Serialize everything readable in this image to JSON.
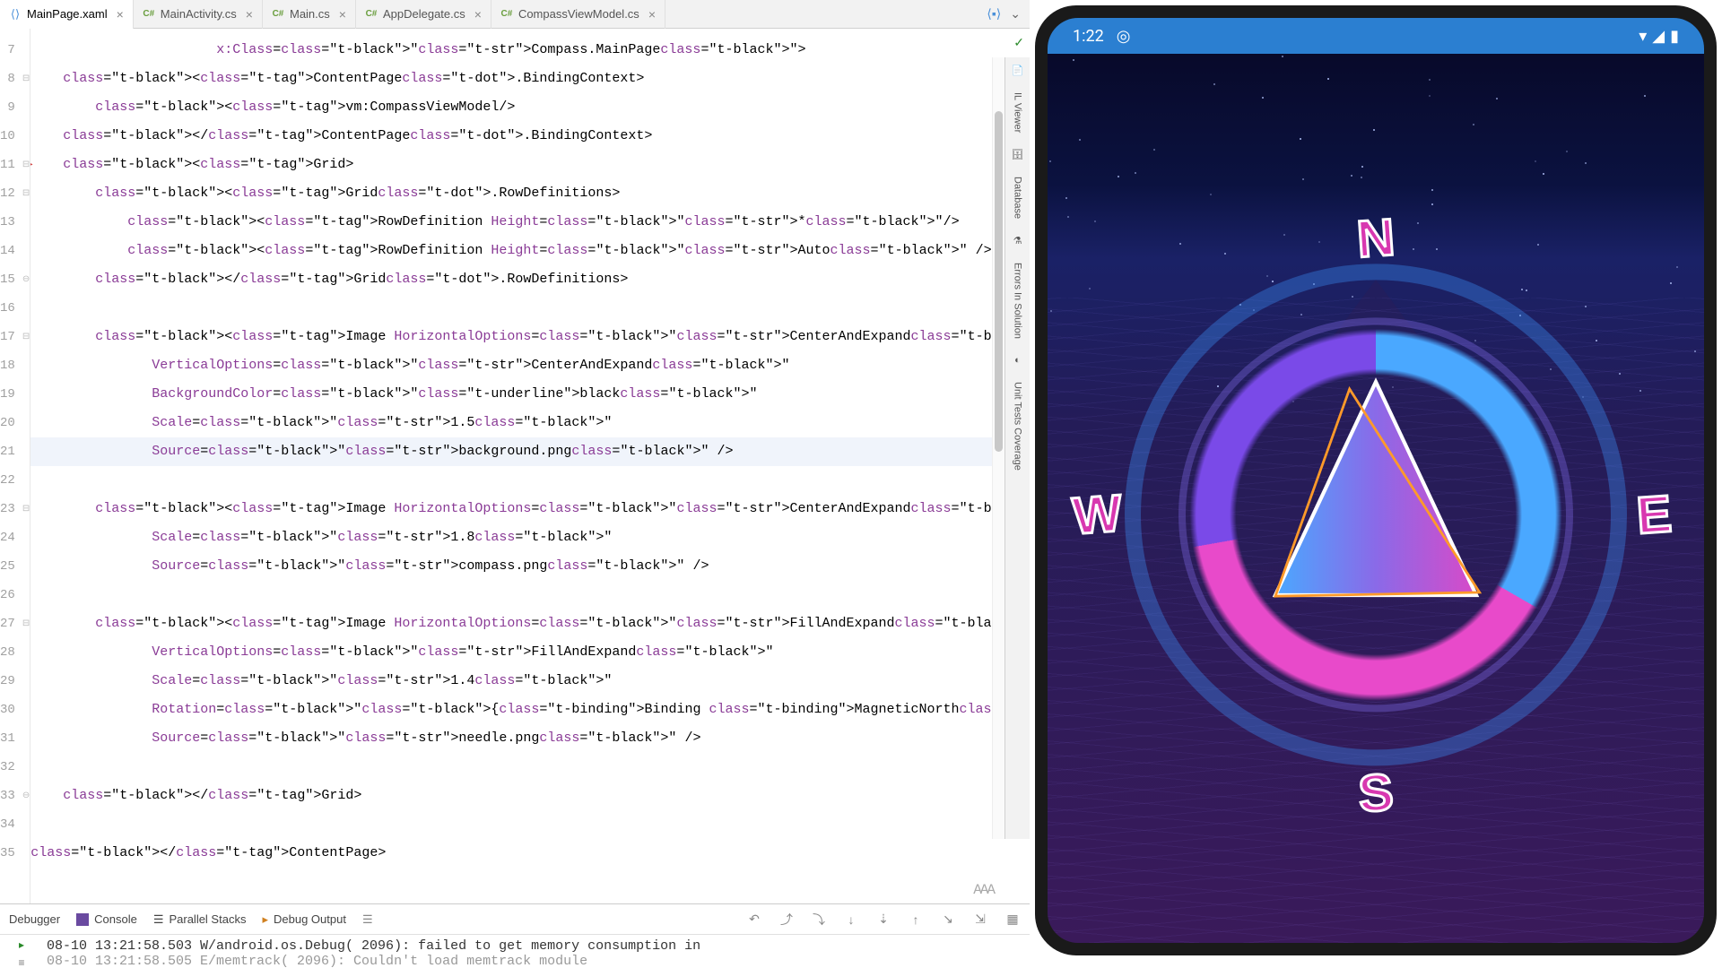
{
  "tabs": [
    {
      "label": "MainPage.xaml",
      "icon": "⟨⟩",
      "color": "#4a90d9",
      "active": true
    },
    {
      "label": "MainActivity.cs",
      "icon": "C#",
      "color": "#6a9e3e"
    },
    {
      "label": "Main.cs",
      "icon": "C#",
      "color": "#6a9e3e"
    },
    {
      "label": "AppDelegate.cs",
      "icon": "C#",
      "color": "#6a9e3e"
    },
    {
      "label": "CompassViewModel.cs",
      "icon": "C#",
      "color": "#6a9e3e"
    }
  ],
  "lines": {
    "start": 7,
    "end": 35,
    "highlight": 21,
    "breakpoint": 11,
    "hammer": 21
  },
  "code": {
    "l7": "                       x:Class=\"Compass.MainPage\">",
    "l8": "    <ContentPage.BindingContext>",
    "l9": "        <vm:CompassViewModel/>",
    "l10": "    </ContentPage.BindingContext>",
    "l11": "    <Grid>",
    "l12": "        <Grid.RowDefinitions>",
    "l13": "            <RowDefinition Height=\"*\"/>",
    "l14": "            <RowDefinition Height=\"Auto\" />",
    "l15": "        </Grid.RowDefinitions>",
    "l16": "",
    "l17": "        <Image HorizontalOptions=\"CenterAndExpand\"",
    "l18": "               VerticalOptions=\"CenterAndExpand\"",
    "l19": "               BackgroundColor=\"black\"",
    "l20": "               Scale=\"1.5\"",
    "l21": "               Source=\"background.png\" />",
    "l22": "",
    "l23": "        <Image HorizontalOptions=\"CenterAndExpand\"",
    "l24": "               Scale=\"1.8\"",
    "l25": "               Source=\"compass.png\" />",
    "l26": "",
    "l27": "        <Image HorizontalOptions=\"FillAndExpand\"",
    "l28": "               VerticalOptions=\"FillAndExpand\"",
    "l29": "               Scale=\"1.4\"",
    "l30": "               Rotation=\"{Binding MagneticNorth}\"",
    "l31": "               Source=\"needle.png\" />",
    "l32": "",
    "l33": "    </Grid>",
    "l34": "",
    "l35": "</ContentPage>"
  },
  "right_panels": [
    "IL Viewer",
    "Database",
    "Errors In Solution",
    "Unit Tests Coverage"
  ],
  "debug": {
    "tabs": [
      "Debugger",
      "Console",
      "Parallel Stacks",
      "Debug Output"
    ],
    "output_line1": "08-10 13:21:58.503 W/android.os.Debug( 2096): failed to get memory consumption in",
    "output_line2": "08-10 13:21:58.505 E/memtrack( 2096): Couldn't load memtrack module"
  },
  "emu": {
    "time": "1:22",
    "directions": {
      "n": "N",
      "s": "S",
      "e": "E",
      "w": "W"
    }
  }
}
